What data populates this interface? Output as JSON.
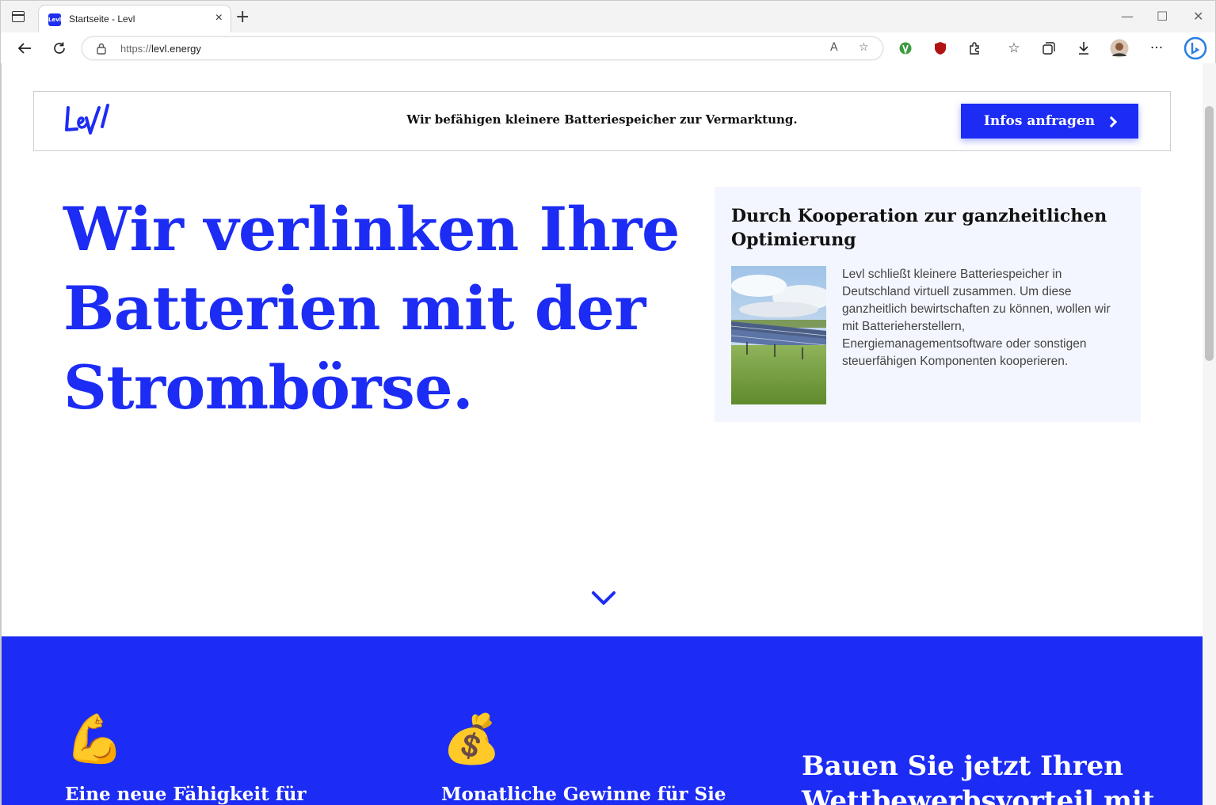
{
  "browser": {
    "tab_title": "Startseite - Levl",
    "favicon_text": "Levl",
    "url_protocol": "https://",
    "url_host": "levl.energy",
    "new_tab_glyph": "+",
    "close_glyph": "×",
    "minimize_glyph": "—",
    "maximize_glyph": "☐",
    "window_close_glyph": "✕"
  },
  "header": {
    "tagline": "Wir befähigen kleinere Batteriespeicher zur Vermarktung.",
    "cta_label": "Infos anfragen"
  },
  "hero": {
    "title": "Wir verlinken Ihre Batterien mit der Strombörse."
  },
  "card": {
    "title": "Durch Kooperation zur ganzheitlichen Optimierung",
    "text": "Levl schließt kleinere Batteriespeicher in Deutschland virtuell zusammen. Um diese ganzheitlich bewirtschaften zu können, wollen wir mit Batterieherstellern, Energiemanagementsoftware oder sonstigen steuerfähigen Komponenten kooperieren."
  },
  "features": {
    "items": [
      {
        "icon": "💪",
        "icon_name": "flexed-biceps-icon",
        "title": "Eine neue Fähigkeit für"
      },
      {
        "icon": "💰",
        "icon_name": "money-bag-icon",
        "title": "Monatliche Gewinne für Sie"
      }
    ],
    "headline": "Bauen Sie jetzt Ihren Wettbewerbsvorteil mit"
  },
  "colors": {
    "brand_blue": "#1c2cf4",
    "card_bg": "#f3f6fe"
  }
}
